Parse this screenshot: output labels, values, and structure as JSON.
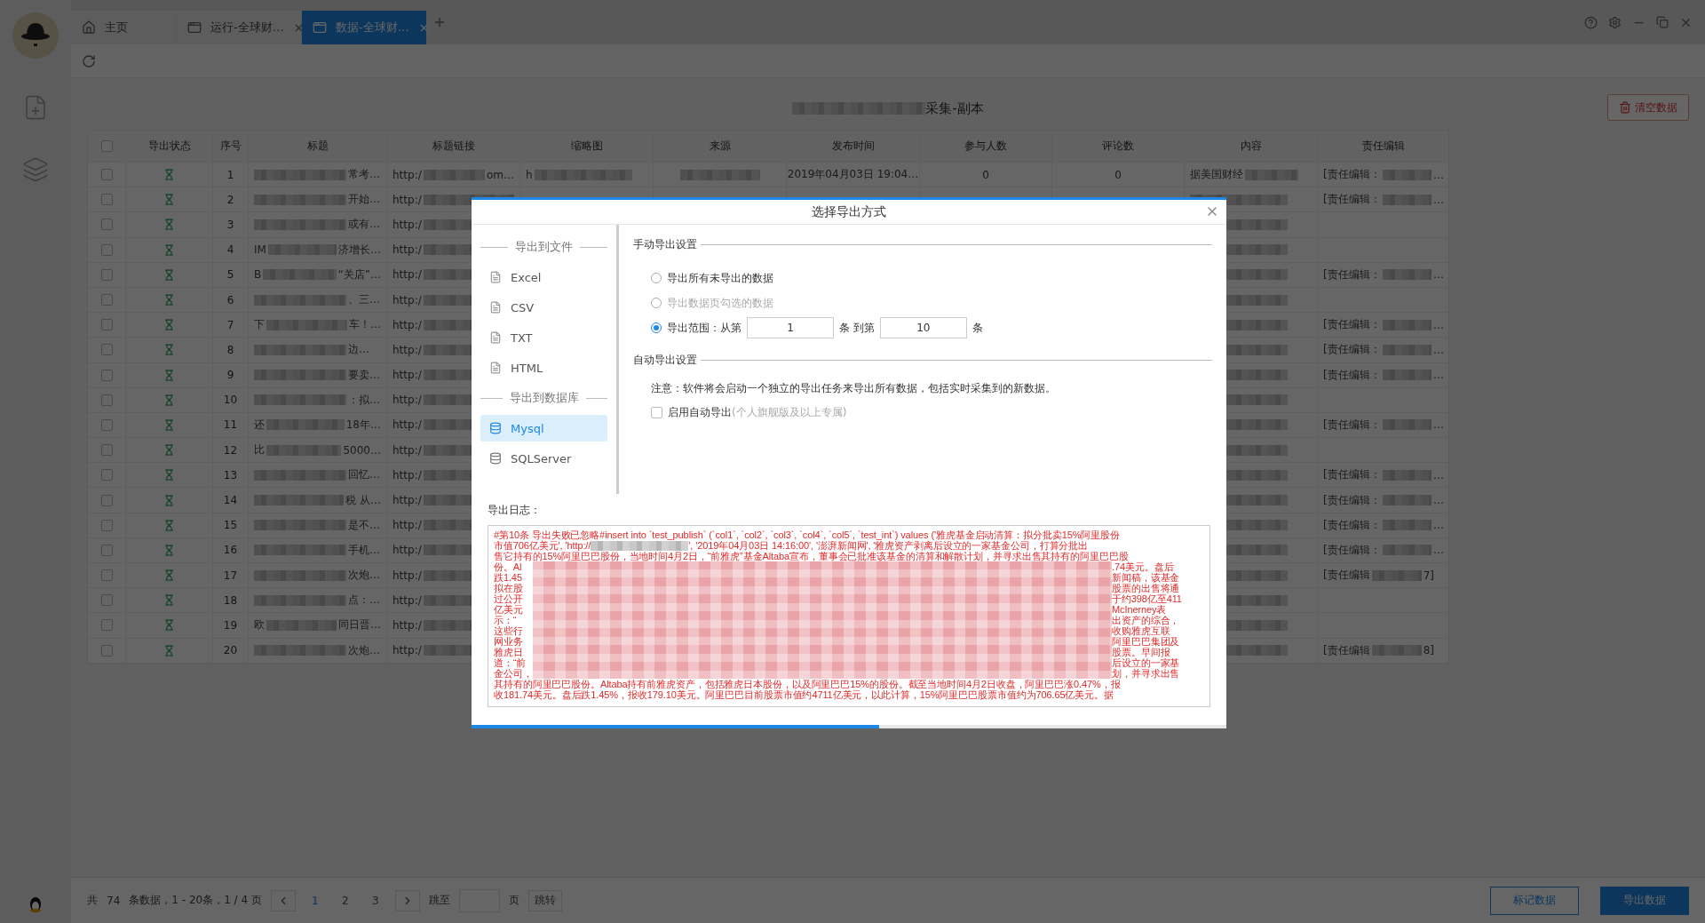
{
  "tabs": [
    {
      "kind": "home",
      "label": "主页",
      "selected": false
    },
    {
      "kind": "page",
      "label": "运行-全球财…",
      "selected": false
    },
    {
      "kind": "page",
      "label": "数据-全球财…",
      "selected": true
    }
  ],
  "header": {
    "title": "采集-副本",
    "clear_button": "清空数据"
  },
  "table": {
    "header_checked": false,
    "columns": [
      "导出状态",
      "序号",
      "标题",
      "标题链接",
      "缩略图",
      "来源",
      "发布时间",
      "参与人数",
      "评论数",
      "内容",
      "责任编辑"
    ],
    "rows": [
      {
        "checked": false,
        "index": "1",
        "title_end": "常考…",
        "link": "http:/",
        "link_end": "om…",
        "thumbnail": "h",
        "published": "2019年04月03日 19:04…",
        "participants": "0",
        "comments": "0",
        "content": "据美国财经",
        "editor": "[责任编辑：",
        "editor_end": "…"
      },
      {
        "checked": false,
        "index": "2",
        "title_end": "开始…",
        "link": "http:/",
        "editor": "[责任编辑：",
        "editor_end": "…"
      },
      {
        "checked": false,
        "index": "3",
        "title_end": "或有…",
        "link": "http:/"
      },
      {
        "checked": false,
        "index": "4",
        "title_start": "IM",
        "title_end": "济增长…",
        "link": "http:/"
      },
      {
        "checked": false,
        "index": "5",
        "title_start": "B",
        "title_end": "“关店”…",
        "link": "http:/",
        "editor": "[责任编辑：",
        "editor_end": "…"
      },
      {
        "checked": false,
        "index": "6",
        "title_end": "、三…",
        "link": "http:/"
      },
      {
        "checked": false,
        "index": "7",
        "title_start": "下",
        "title_end": "车！…",
        "link": "http:/",
        "editor": "[责任编辑：",
        "editor_end": "…"
      },
      {
        "checked": false,
        "index": "8",
        "title_end": "边…",
        "link": "http:/",
        "editor": "[责任编辑：",
        "editor_end": "…"
      },
      {
        "checked": false,
        "index": "9",
        "title_end": "要卖…",
        "link": "http:/",
        "editor": "[责任编辑：",
        "editor_end": "…"
      },
      {
        "checked": false,
        "index": "10",
        "title_end": "：拟…",
        "link": "http:/"
      },
      {
        "checked": false,
        "index": "11",
        "title_start": "还",
        "title_end": "18年…",
        "link": "http:/",
        "editor": "[责任编辑：",
        "editor_end": "…"
      },
      {
        "checked": false,
        "index": "12",
        "title_start": "比",
        "title_end": "5000…",
        "link": "http:/"
      },
      {
        "checked": false,
        "index": "13",
        "title_end": "回忆…",
        "link": "http:/",
        "editor": "[责任编辑：",
        "editor_end": "…"
      },
      {
        "checked": false,
        "index": "14",
        "title_end": "税 从…",
        "link": "http:/",
        "editor": "[责任编辑：",
        "editor_end": "…"
      },
      {
        "checked": false,
        "index": "15",
        "title_end": "是不…",
        "link": "http:/",
        "editor": "[责任编辑：",
        "editor_end": "…"
      },
      {
        "checked": false,
        "index": "16",
        "title_end": "手机…",
        "link": "http:/",
        "editor": "[责任编辑：",
        "editor_end": "…"
      },
      {
        "checked": false,
        "index": "17",
        "title_end": "次炮…",
        "link": "http:/",
        "editor": "[责任编辑",
        "editor_end": "7]"
      },
      {
        "checked": false,
        "index": "18",
        "title_end": "点：…",
        "link": "http:/"
      },
      {
        "checked": false,
        "index": "19",
        "title_start": "欧",
        "title_end": "同日晋…",
        "link": "http:/"
      },
      {
        "checked": false,
        "index": "20",
        "title_end": "次炮…",
        "link": "http:/",
        "editor": "[责任编辑",
        "editor_end": "8]"
      }
    ]
  },
  "pagination": {
    "total_prefix": "共",
    "total": "74",
    "summary": "条数据，1 - 20条，1 / 4 页",
    "pages": [
      {
        "label": "1",
        "selected": true
      },
      {
        "label": "2",
        "selected": false
      },
      {
        "label": "3",
        "selected": false
      }
    ],
    "jump_label": "跳至",
    "page_unit": "页",
    "jump_button": "跳转"
  },
  "actions": [
    {
      "label": "标记数据",
      "primary": false
    },
    {
      "label": "导出数据",
      "primary": true
    }
  ],
  "dialog": {
    "title": "选择导出方式",
    "sections": [
      {
        "label": "导出到文件",
        "items": [
          {
            "kind": "file",
            "label": "Excel",
            "selected": false
          },
          {
            "kind": "file",
            "label": "CSV",
            "selected": false
          },
          {
            "kind": "file",
            "label": "TXT",
            "selected": false
          },
          {
            "kind": "file",
            "label": "HTML",
            "selected": false
          }
        ]
      },
      {
        "label": "导出到数据库",
        "items": [
          {
            "kind": "database",
            "label": "Mysql",
            "selected": true
          },
          {
            "kind": "database",
            "label": "SQLServer",
            "selected": false
          }
        ]
      }
    ],
    "manual": {
      "title": "手动导出设置",
      "options": [
        {
          "kind": "plain",
          "label": "导出所有未导出的数据",
          "selected": false,
          "disabled": false
        },
        {
          "kind": "plain",
          "label": "导出数据页勾选的数据",
          "selected": false,
          "disabled": true
        },
        {
          "kind": "range",
          "label": "导出范围：从第",
          "from": "1",
          "mid": "条 到第",
          "to": "10",
          "unit": "条",
          "selected": true,
          "disabled": false
        }
      ]
    },
    "auto": {
      "title": "自动导出设置",
      "note": "注意：软件将会启动一个独立的导出任务来导出所有数据，包括实时采集到的新数据。",
      "checkbox": {
        "label": "启用自动导出",
        "hint": "(个人旗舰版及以上专属)",
        "checked": false
      }
    },
    "log": {
      "label": "导出日志：",
      "head": [
        "#第10条 导出失败已忽略#insert into `test_publish` (`col1`, `col2`, `col3`, `col4`, `col5`, `test_int`) values ('雅虎基金启动清算：拟分批卖15%阿里股份",
        "市值706亿美元', 'http://"
      ],
      "head_rest": [
        "', '2019年04月03日 14:16:00', '澎湃新闻网', '雅虎资产剥离后设立的一家基金公司，打算分批出",
        "售它持有的15%阿里巴巴股份，当地时间4月2日，“前雅虎”基金Altaba宣布，董事会已批准该基金的清算和解散计划，并寻求出售其持有的阿里巴巴股"
      ],
      "left_fragments": [
        "份。Al",
        "跌1.45",
        "拟在股",
        "过公开",
        "亿美元",
        "示：“",
        "这些行",
        "网业务",
        "雅虎日",
        "道：“前",
        "金公司，"
      ],
      "right_fragments": [
        ".74美元。盘后",
        "新闻稿，该基金",
        "股票的出售将通",
        "于约398亿至411",
        "McInerney表",
        "出资产的综合，",
        "收购雅虎互联",
        "阿里巴巴集团及",
        "股票。早间报",
        "后设立的一家基",
        "划，并寻求出售"
      ],
      "tail": [
        "其持有的阿里巴巴股份。Altaba持有前雅虎资产，包括雅虎日本股份，以及阿里巴巴15%的股份。截至当地时间4月2日收盘，阿里巴巴涨0.47%，报",
        "收181.74美元。盘后跌1.45%，报收179.10美元。阿里巴巴目前股票市值约4711亿美元，以此计算，15%阿里巴巴股票市值约为706.65亿美元。据"
      ]
    },
    "progress": {
      "level": 0.54
    }
  }
}
